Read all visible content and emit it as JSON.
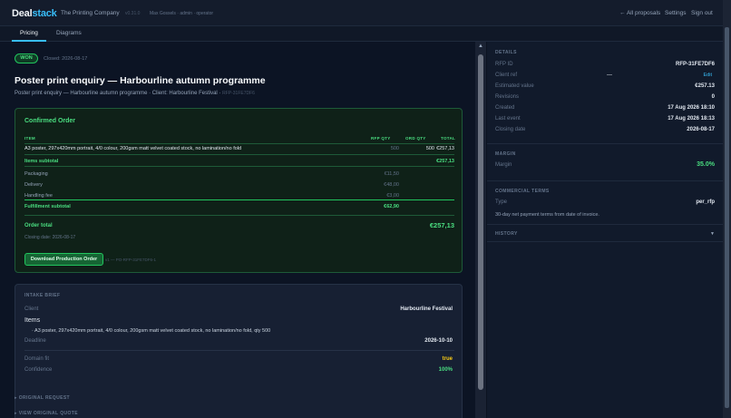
{
  "header": {
    "logo_main": "Deal",
    "logo_accent": "stack",
    "company": "The Printing Company",
    "version": "v0.31.0",
    "user": "Max Gossels · admin · operator",
    "nav_all_proposals": "← All proposals",
    "nav_settings": "Settings",
    "nav_signout": "Sign out"
  },
  "tabs": [
    {
      "label": "Pricing",
      "active": true
    },
    {
      "label": "Diagrams",
      "active": false
    }
  ],
  "status": {
    "badge": "WON",
    "closed": "Closed: 2026-08-17"
  },
  "proposal": {
    "title": "Poster print enquiry — Harbourline autumn programme",
    "subtitle": "Poster print enquiry — Harbourline autumn programme · Client: Harbourline Festival · ",
    "ref": "RFP-31FE7DF6"
  },
  "order": {
    "title": "Confirmed Order",
    "columns": {
      "item": "ITEM",
      "rfp_qty": "RFP QTY",
      "ord_qty": "ORD QTY",
      "total": "TOTAL"
    },
    "lines": [
      {
        "item": "A3 poster, 297x420mm portrait, 4/0 colour, 200gsm matt velvet coated stock, no lamination/no fold",
        "rfp_qty": "500",
        "ord_qty": "500",
        "total": "€257,13"
      }
    ],
    "items_subtotal_label": "Items subtotal",
    "items_subtotal": "€257,13",
    "fees": [
      {
        "label": "Packaging",
        "value": "€11,50"
      },
      {
        "label": "Delivery",
        "value": "€48,00"
      },
      {
        "label": "Handling fee",
        "value": "€3,00"
      }
    ],
    "fulfillment_subtotal_label": "Fulfillment subtotal",
    "fulfillment_subtotal": "€62,90",
    "order_total_label": "Order total",
    "order_total": "€257,13",
    "closing_date": "Closing date: 2026-08-17",
    "download_label": "Download Production Order",
    "download_ref": "v1 — PO-RFP-31FE7DF6-1"
  },
  "brief": {
    "label": "INTAKE BRIEF",
    "client_label": "Client",
    "client_value": "Harbourline Festival",
    "items_label": "Items",
    "items_line": "· A3 poster, 297x420mm portrait, 4/0 colour, 200gsm matt velvet coated stock, no lamination/no fold, qty 500",
    "deadline_label": "Deadline",
    "deadline_value": "2026-10-10",
    "domain_fit_label": "Domain fit",
    "domain_fit_value": "true",
    "confidence_label": "Confidence",
    "confidence_value": "100%"
  },
  "collapsibles": {
    "original_request": "▸  ORIGINAL REQUEST",
    "original_quote": "▸  VIEW ORIGINAL QUOTE"
  },
  "details": {
    "label": "DETAILS",
    "rfp_id_label": "RFP ID",
    "rfp_id": "RFP-31FE7DF6",
    "client_ref_label": "Client ref",
    "client_ref": "—",
    "edit_label": "Edit",
    "estimated_value_label": "Estimated value",
    "estimated_value": "€257.13",
    "revisions_label": "Revisions",
    "revisions": "0",
    "created_label": "Created",
    "created": "17 Aug 2026 18:10",
    "last_event_label": "Last event",
    "last_event": "17 Aug 2026 18:13",
    "closing_date_label": "Closing date",
    "closing_date": "2026-08-17"
  },
  "margin": {
    "label": "MARGIN",
    "margin_label": "Margin",
    "margin_value": "35.0%"
  },
  "terms": {
    "label": "COMMERCIAL TERMS",
    "type_label": "Type",
    "type_value": "per_rfp",
    "text": "30-day net payment terms from date of invoice."
  },
  "history": {
    "label": "HISTORY",
    "arrow": "▼"
  },
  "colors": {
    "accent": "#38bdf8",
    "success": "#4ade80",
    "warning": "#facc15",
    "background": "#0b1220"
  }
}
